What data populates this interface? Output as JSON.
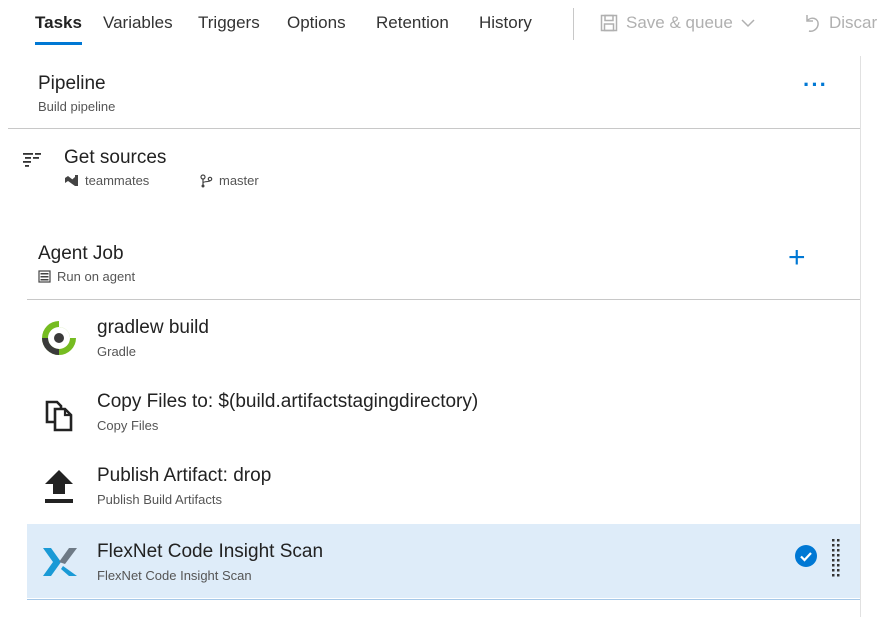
{
  "toolbar": {
    "tabs": [
      {
        "label": "Tasks",
        "active": true
      },
      {
        "label": "Variables",
        "active": false
      },
      {
        "label": "Triggers",
        "active": false
      },
      {
        "label": "Options",
        "active": false
      },
      {
        "label": "Retention",
        "active": false
      },
      {
        "label": "History",
        "active": false
      }
    ],
    "save_label": "Save & queue",
    "discard_label": "Discar"
  },
  "pipeline": {
    "title": "Pipeline",
    "subtitle": "Build pipeline"
  },
  "sources": {
    "title": "Get sources",
    "repo": "teammates",
    "branch": "master"
  },
  "agent_job": {
    "title": "Agent Job",
    "subtitle": "Run on agent"
  },
  "tasks": [
    {
      "title": "gradlew build",
      "subtitle": "Gradle",
      "icon": "gradle-icon"
    },
    {
      "title": "Copy Files to: $(build.artifactstagingdirectory)",
      "subtitle": "Copy Files",
      "icon": "copy-files-icon"
    },
    {
      "title": "Publish Artifact: drop",
      "subtitle": "Publish Build Artifacts",
      "icon": "publish-upload-icon"
    },
    {
      "title": "FlexNet Code Insight Scan",
      "subtitle": "FlexNet Code Insight Scan",
      "icon": "flexnet-icon",
      "selected": true
    }
  ],
  "colors": {
    "accent": "#0078d4",
    "selected_bg": "#deecf9",
    "gradle_green": "#76bc21"
  }
}
